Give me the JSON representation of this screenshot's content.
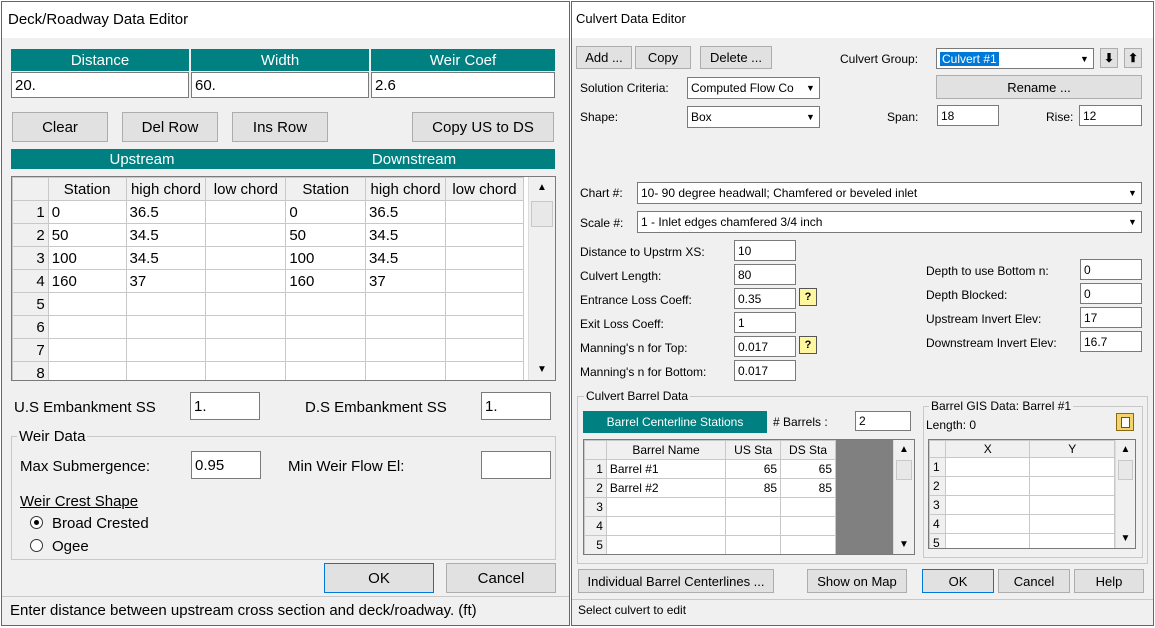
{
  "deck": {
    "title": "Deck/Roadway Data Editor",
    "headers": {
      "distance": "Distance",
      "width": "Width",
      "weir_coef": "Weir Coef"
    },
    "values": {
      "distance": "20.",
      "width": "60.",
      "weir_coef": "2.6"
    },
    "buttons": {
      "clear": "Clear",
      "del_row": "Del Row",
      "ins_row": "Ins Row",
      "copy": "Copy US to DS",
      "ok": "OK",
      "cancel": "Cancel"
    },
    "section_headers": {
      "upstream": "Upstream",
      "downstream": "Downstream"
    },
    "table": {
      "columns": [
        "Station",
        "high chord",
        "low chord",
        "Station",
        "high chord",
        "low chord"
      ],
      "rows": [
        {
          "n": "1",
          "c": [
            "0",
            "36.5",
            "",
            "0",
            "36.5",
            ""
          ]
        },
        {
          "n": "2",
          "c": [
            "50",
            "34.5",
            "",
            "50",
            "34.5",
            ""
          ]
        },
        {
          "n": "3",
          "c": [
            "100",
            "34.5",
            "",
            "100",
            "34.5",
            ""
          ]
        },
        {
          "n": "4",
          "c": [
            "160",
            "37",
            "",
            "160",
            "37",
            ""
          ]
        },
        {
          "n": "5",
          "c": [
            "",
            "",
            "",
            "",
            "",
            ""
          ]
        },
        {
          "n": "6",
          "c": [
            "",
            "",
            "",
            "",
            "",
            ""
          ]
        },
        {
          "n": "7",
          "c": [
            "",
            "",
            "",
            "",
            "",
            ""
          ]
        },
        {
          "n": "8",
          "c": [
            "",
            "",
            "",
            "",
            "",
            ""
          ]
        }
      ]
    },
    "us_embankment_label": "U.S Embankment SS",
    "us_embankment_value": "1.",
    "ds_embankment_label": "D.S Embankment SS",
    "ds_embankment_value": "1.",
    "weir_data_title": "Weir Data",
    "max_submergence_label": "Max  Submergence:",
    "max_submergence_value": "0.95",
    "min_weir_label": "Min Weir Flow El:",
    "min_weir_value": "",
    "weir_shape_label": "Weir Crest Shape",
    "broad_crested": "Broad Crested",
    "ogee": "Ogee",
    "status": "Enter distance between upstream cross section and deck/roadway. (ft)"
  },
  "culvert": {
    "title": "Culvert Data Editor",
    "buttons": {
      "add": "Add ...",
      "copy": "Copy",
      "delete": "Delete ...",
      "rename": "Rename ...",
      "individual": "Individual Barrel Centerlines ...",
      "show_map": "Show on Map",
      "ok": "OK",
      "cancel": "Cancel",
      "help": "Help"
    },
    "group_label": "Culvert Group:",
    "group_value": "Culvert #1",
    "solution_label": "Solution Criteria:",
    "solution_value": "Computed Flow Co",
    "shape_label": "Shape:",
    "shape_value": "Box",
    "span_label": "Span:",
    "span_value": "18",
    "rise_label": "Rise:",
    "rise_value": "12",
    "chart_label": "Chart #:",
    "chart_value": "10- 90 degree headwall; Chamfered or beveled inlet",
    "scale_label": "Scale #:",
    "scale_value": "1 - Inlet edges chamfered 3/4 inch",
    "fields_left": [
      {
        "label": "Distance to Upstrm XS:",
        "value": "10"
      },
      {
        "label": "Culvert Length:",
        "value": "80"
      },
      {
        "label": "Entrance Loss Coeff:",
        "value": "0.35"
      },
      {
        "label": "Exit Loss Coeff:",
        "value": "1"
      },
      {
        "label": "Manning's n for Top:",
        "value": "0.017"
      },
      {
        "label": "Manning's n for Bottom:",
        "value": "0.017"
      }
    ],
    "fields_right": [
      {
        "label": "Depth to use Bottom n:",
        "value": "0"
      },
      {
        "label": "Depth Blocked:",
        "value": "0"
      },
      {
        "label": "Upstream Invert Elev:",
        "value": "17"
      },
      {
        "label": "Downstream Invert Elev:",
        "value": "16.7"
      }
    ],
    "help_glyph": "?",
    "barrel_title": "Culvert Barrel Data",
    "barrel_tab": "Barrel Centerline Stations",
    "barrels_label": "# Barrels :",
    "barrels_value": "2",
    "barrel_table": {
      "columns": [
        "Barrel Name",
        "US Sta",
        "DS Sta"
      ],
      "rows": [
        {
          "n": "1",
          "c": [
            "Barrel #1",
            "65",
            "65"
          ]
        },
        {
          "n": "2",
          "c": [
            "Barrel #2",
            "85",
            "85"
          ]
        },
        {
          "n": "3",
          "c": [
            "",
            "",
            ""
          ]
        },
        {
          "n": "4",
          "c": [
            "",
            "",
            ""
          ]
        },
        {
          "n": "5",
          "c": [
            "",
            "",
            ""
          ]
        }
      ]
    },
    "gis_title": "Barrel GIS Data: Barrel #1",
    "gis_length": "Length: 0",
    "gis_table": {
      "columns": [
        "X",
        "Y"
      ],
      "rows": [
        "1",
        "2",
        "3",
        "4",
        "5"
      ]
    },
    "status": "Select culvert to edit"
  },
  "colors": {
    "teal": "#008080",
    "border": "#1979ca",
    "face": "#f0f0f0"
  },
  "icons": [
    "scroll-up-icon",
    "scroll-down-icon",
    "dropdown-arrow-icon",
    "move-down-icon",
    "move-up-icon",
    "help-icon",
    "paste-table-icon",
    "radio-selected-icon",
    "radio-empty-icon"
  ]
}
